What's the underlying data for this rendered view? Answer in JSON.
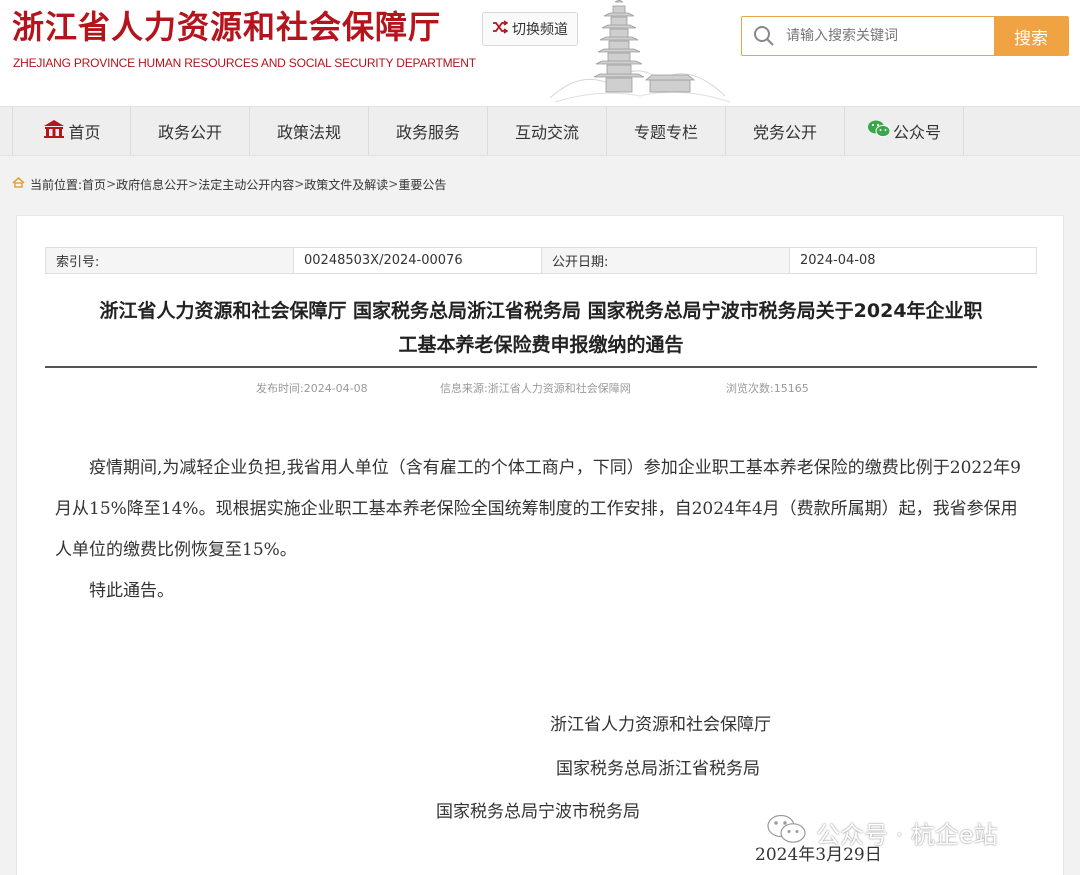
{
  "header": {
    "title_cn": "浙江省人力资源和社会保障厅",
    "title_en": "ZHEJIANG PROVINCE HUMAN RESOURCES AND SOCIAL SECURITY DEPARTMENT",
    "switch_channel": "切换频道",
    "search_placeholder": "请输入搜索关键词",
    "search_button": "搜索",
    "brand_color": "#b4141b",
    "accent_color": "#f0a342"
  },
  "nav": {
    "items": [
      {
        "label": "首页",
        "icon": "home-icon"
      },
      {
        "label": "政务公开"
      },
      {
        "label": "政策法规"
      },
      {
        "label": "政务服务"
      },
      {
        "label": "互动交流"
      },
      {
        "label": "专题专栏"
      },
      {
        "label": "党务公开"
      },
      {
        "label": "公众号",
        "icon": "wechat-icon"
      }
    ]
  },
  "breadcrumb": {
    "prefix": "当前位置:",
    "items": [
      "首页",
      "政府信息公开",
      "法定主动公开内容",
      "政策文件及解读",
      "重要公告"
    ],
    "separator": ">"
  },
  "meta": {
    "index_label": "索引号:",
    "index_value": "00248503X/2024-00076",
    "date_label": "公开日期:",
    "date_value": "2024-04-08"
  },
  "article": {
    "title_line1": "浙江省人力资源和社会保障厅 国家税务总局浙江省税务局 国家税务总局宁波市税务局关于2024年企业职",
    "title_line2": "工基本养老保险费申报缴纳的通告",
    "publish_time": "发布时间:2024-04-08",
    "source": "信息来源:浙江省人力资源和社会保障网",
    "views": "浏览次数:15165",
    "paragraph1": "疫情期间,为减轻企业负担,我省用人单位（含有雇工的个体工商户，下同）参加企业职工基本养老保险的缴费比例于2022年9月从15%降至14%。现根据实施企业职工基本养老保险全国统筹制度的工作安排，自2024年4月（费款所属期）起，我省参保用人单位的缴费比例恢复至15%。",
    "paragraph2": "特此通告。",
    "signatures": [
      "浙江省人力资源和社会保障厅",
      "国家税务总局浙江省税务局",
      "国家税务总局宁波市税务局"
    ],
    "sign_date": "2024年3月29日"
  },
  "watermark": {
    "text": "公众号 · 杭企e站",
    "icon": "wechat-icon"
  }
}
